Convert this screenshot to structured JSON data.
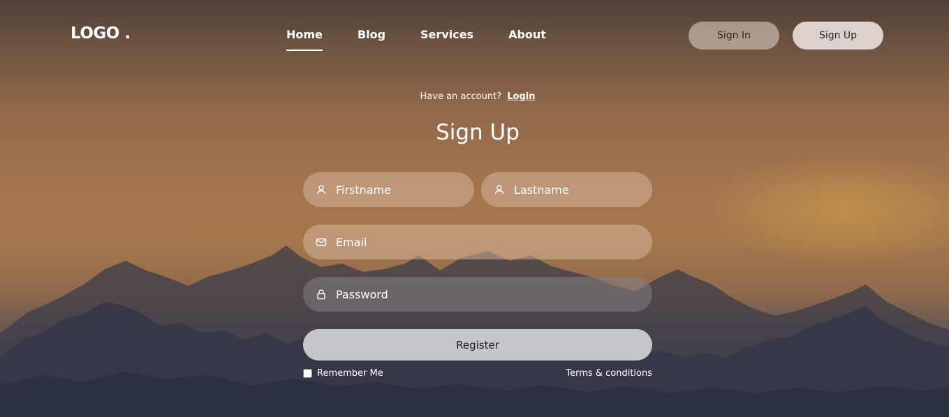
{
  "brand": {
    "logo": "LOGO ."
  },
  "nav": {
    "items": [
      {
        "label": "Home",
        "active": true
      },
      {
        "label": "Blog",
        "active": false
      },
      {
        "label": "Services",
        "active": false
      },
      {
        "label": "About",
        "active": false
      }
    ]
  },
  "header_buttons": {
    "sign_in": "Sign In",
    "sign_up": "Sign Up"
  },
  "form": {
    "have_account_text": "Have an account?",
    "login_link": "Login",
    "title": "Sign Up",
    "firstname_placeholder": "Firstname",
    "lastname_placeholder": "Lastname",
    "email_placeholder": "Email",
    "password_placeholder": "Password",
    "register_label": "Register",
    "remember_label": "Remember Me",
    "remember_checked": false,
    "terms_label": "Terms & conditions"
  },
  "icons": {
    "firstname": "user-icon",
    "lastname": "user-icon",
    "email": "envelope-icon",
    "password": "lock-icon"
  },
  "colors": {
    "text": "#ffffff",
    "register_button": "#c5c6ca",
    "sign_up_button": "#ddd2cb"
  }
}
